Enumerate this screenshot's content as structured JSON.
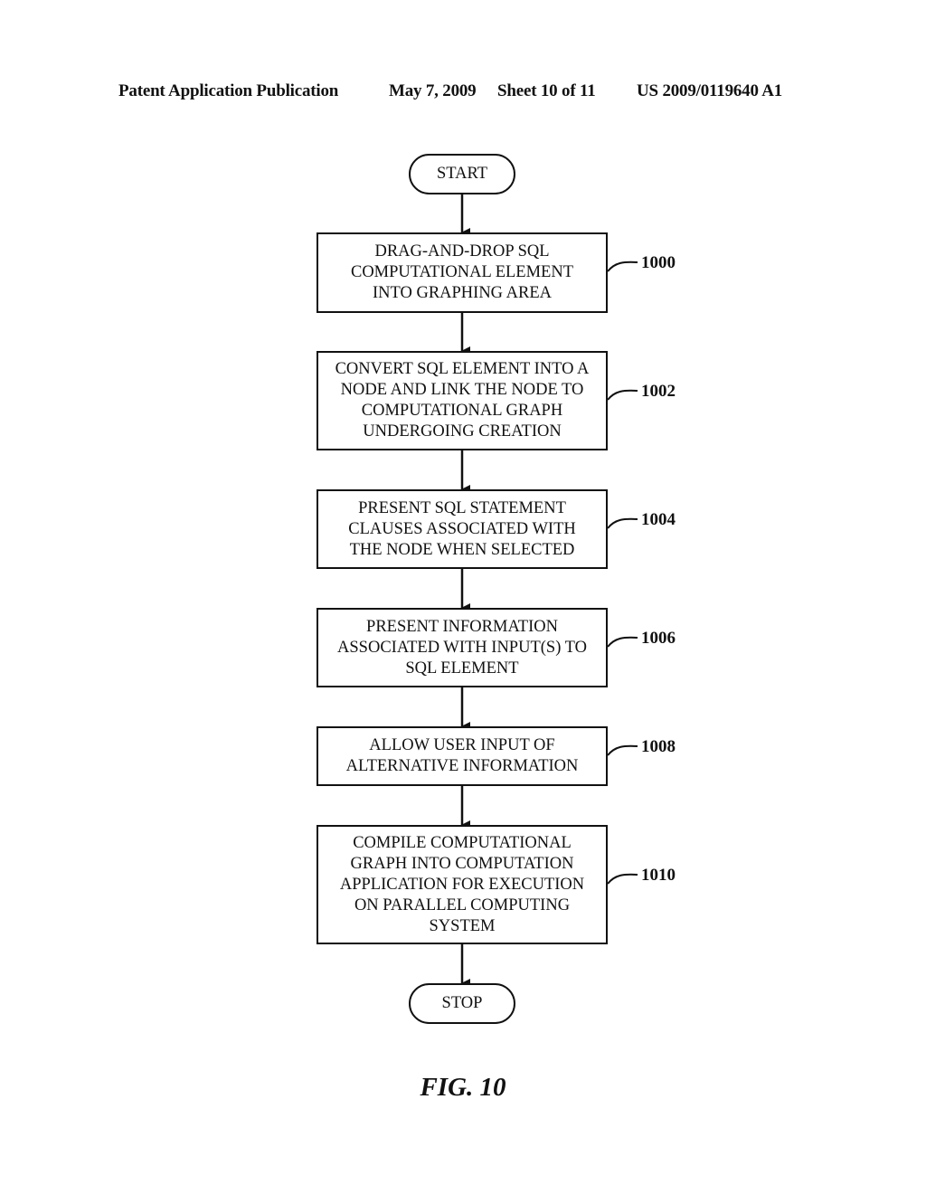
{
  "header": {
    "publication": "Patent Application Publication",
    "date": "May 7, 2009",
    "sheet": "Sheet 10 of 11",
    "number": "US 2009/0119640 A1"
  },
  "flowchart": {
    "start": "START",
    "stop": "STOP",
    "steps": [
      {
        "ref": "1000",
        "lines": [
          "DRAG-AND-DROP SQL",
          "COMPUTATIONAL ELEMENT",
          "INTO GRAPHING AREA"
        ]
      },
      {
        "ref": "1002",
        "lines": [
          "CONVERT SQL ELEMENT INTO A",
          "NODE AND LINK THE NODE TO",
          "COMPUTATIONAL GRAPH",
          "UNDERGOING CREATION"
        ]
      },
      {
        "ref": "1004",
        "lines": [
          "PRESENT SQL STATEMENT",
          "CLAUSES ASSOCIATED WITH",
          "THE NODE WHEN SELECTED"
        ]
      },
      {
        "ref": "1006",
        "lines": [
          "PRESENT INFORMATION",
          "ASSOCIATED WITH INPUT(S) TO",
          "SQL ELEMENT"
        ]
      },
      {
        "ref": "1008",
        "lines": [
          "ALLOW USER INPUT OF",
          "ALTERNATIVE INFORMATION"
        ]
      },
      {
        "ref": "1010",
        "lines": [
          "COMPILE COMPUTATIONAL",
          "GRAPH INTO COMPUTATION",
          "APPLICATION FOR EXECUTION",
          "ON PARALLEL COMPUTING",
          "SYSTEM"
        ]
      }
    ]
  },
  "figure_label": "FIG. 10"
}
